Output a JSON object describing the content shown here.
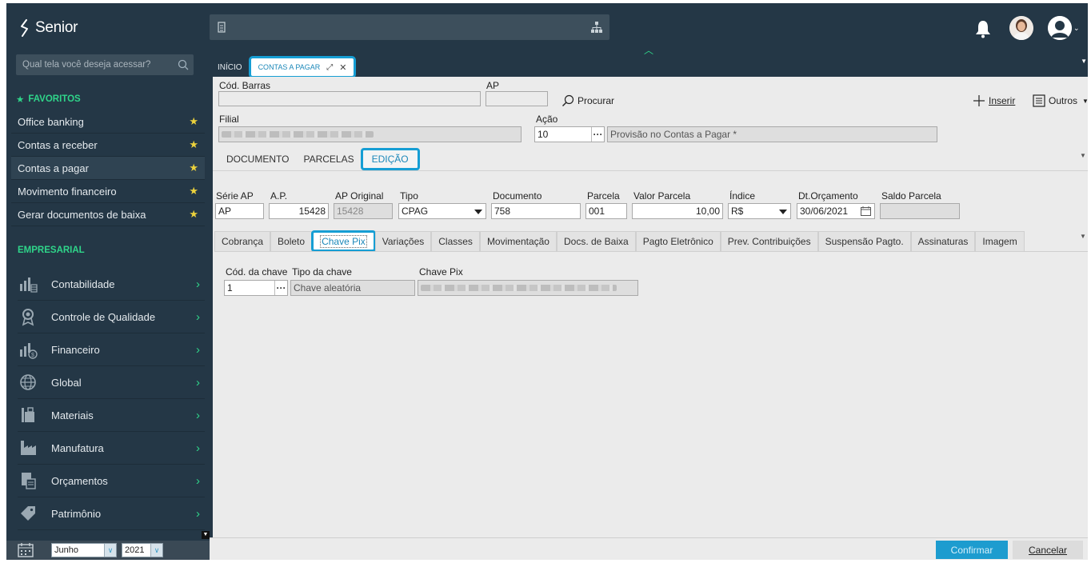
{
  "app": {
    "logo_text": "Senior",
    "menu_search_placeholder": "Qual tela você deseja acessar?"
  },
  "sidebar": {
    "favorites_title": "FAVORITOS",
    "favorites": [
      {
        "label": "Office banking"
      },
      {
        "label": "Contas a receber"
      },
      {
        "label": "Contas a pagar"
      },
      {
        "label": "Movimento financeiro"
      },
      {
        "label": "Gerar documentos de baixa"
      }
    ],
    "business_title": "EMPRESARIAL",
    "modules": [
      {
        "label": "Contabilidade",
        "icon": "accounting-icon"
      },
      {
        "label": "Controle de Qualidade",
        "icon": "quality-icon"
      },
      {
        "label": "Financeiro",
        "icon": "finance-icon"
      },
      {
        "label": "Global",
        "icon": "globe-icon"
      },
      {
        "label": "Materiais",
        "icon": "materials-icon"
      },
      {
        "label": "Manufatura",
        "icon": "factory-icon"
      },
      {
        "label": "Orçamentos",
        "icon": "budget-icon"
      },
      {
        "label": "Patrimônio",
        "icon": "asset-tag-icon"
      }
    ],
    "period": {
      "month": "Junho",
      "year": "2021"
    }
  },
  "tabs": {
    "home": "INÍCIO",
    "active": "CONTAS A PAGAR"
  },
  "form": {
    "cod_barras_label": "Cód. Barras",
    "cod_barras_value": "",
    "ap_label": "AP",
    "ap_value": "",
    "search_label": "Procurar",
    "insert_label": "Inserir",
    "others_label": "Outros",
    "filial_label": "Filial",
    "acao_label": "Ação",
    "acao_value": "10",
    "acao_desc": "Provisão no Contas a Pagar *"
  },
  "subtabs": [
    "DOCUMENTO",
    "PARCELAS",
    "EDIÇÃO"
  ],
  "installment": {
    "serie_ap": {
      "label": "Série AP",
      "value": "AP"
    },
    "ap": {
      "label": "A.P.",
      "value": "15428"
    },
    "ap_original": {
      "label": "AP Original",
      "value": "15428"
    },
    "tipo": {
      "label": "Tipo",
      "value": "CPAG"
    },
    "documento": {
      "label": "Documento",
      "value": "758"
    },
    "parcela": {
      "label": "Parcela",
      "value": "001"
    },
    "valor_parcela": {
      "label": "Valor Parcela",
      "value": "10,00"
    },
    "indice": {
      "label": "Índice",
      "value": "R$"
    },
    "dt_orcamento": {
      "label": "Dt.Orçamento",
      "value": "30/06/2021"
    },
    "saldo_parcela": {
      "label": "Saldo Parcela",
      "value": ""
    }
  },
  "detail_tabs": [
    "Cobrança",
    "Boleto",
    "Chave Pix",
    "Variações",
    "Classes",
    "Movimentação",
    "Docs. de Baixa",
    "Pagto Eletrônico",
    "Prev. Contribuições",
    "Suspensão Pagto.",
    "Assinaturas",
    "Imagem"
  ],
  "pix": {
    "cod_label": "Cód. da chave",
    "cod_value": "1",
    "tipo_label": "Tipo da chave",
    "tipo_value": "Chave aleatória",
    "chave_label": "Chave Pix"
  },
  "footer": {
    "confirm": "Confirmar",
    "cancel": "Cancelar"
  },
  "colors": {
    "sidebar_bg": "#243746",
    "accent_green": "#2fd58a",
    "accent_blue": "#169ed4",
    "star": "#ecd23c"
  }
}
